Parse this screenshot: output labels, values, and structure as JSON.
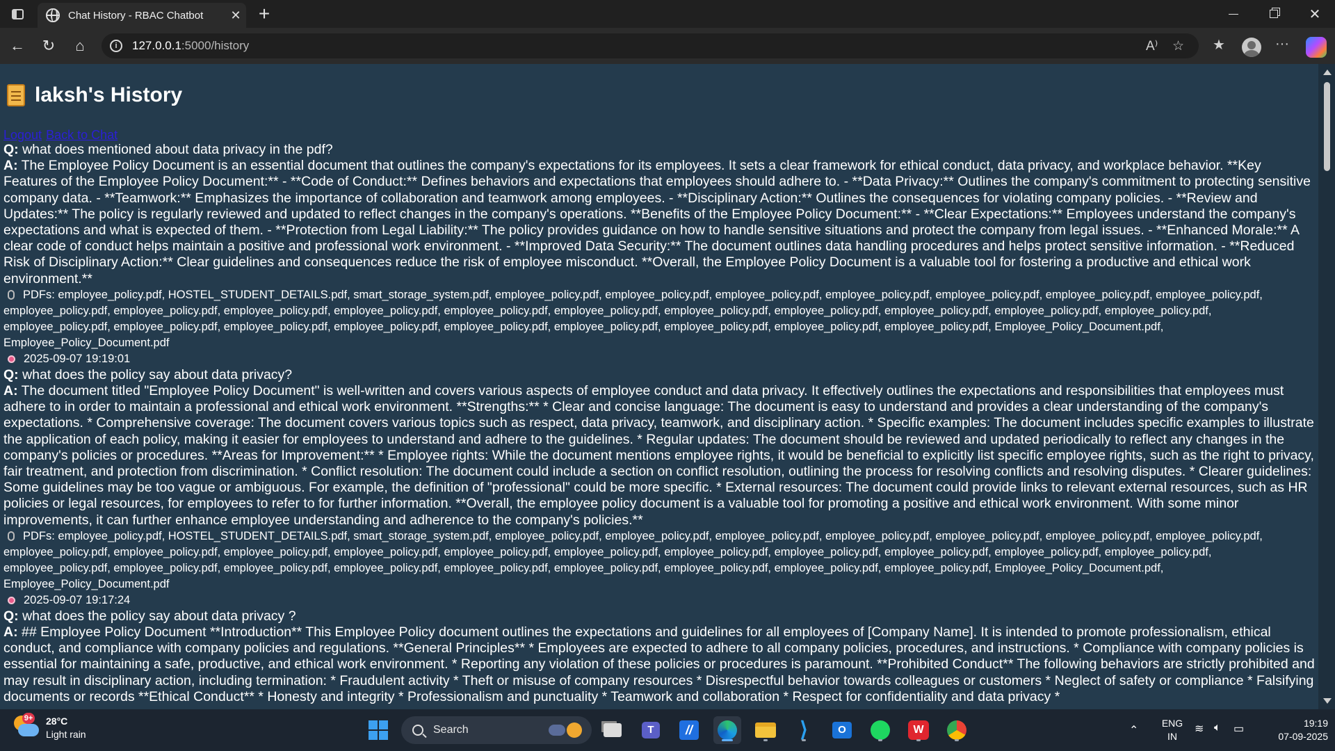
{
  "browser": {
    "tab_title": "Chat History - RBAC Chatbot",
    "tab_close": "✕",
    "new_tab": "+",
    "url_host": "127.0.0.1",
    "url_path": ":5000/history",
    "read_aloud_icon": "A⁾",
    "favorite_star": "☆",
    "favorites_icon": "★",
    "more_menu": "···"
  },
  "page": {
    "title": "laksh's History",
    "links": {
      "logout": "Logout",
      "back_to_chat": "Back to Chat"
    }
  },
  "history": [
    {
      "q_label": "Q:",
      "question": " what does mentioned about data privacy in the pdf?",
      "a_label": "A:",
      "answer": " The Employee Policy Document is an essential document that outlines the company's expectations for its employees. It sets a clear framework for ethical conduct, data privacy, and workplace behavior. **Key Features of the Employee Policy Document:** - **Code of Conduct:** Defines behaviors and expectations that employees should adhere to. - **Data Privacy:** Outlines the company's commitment to protecting sensitive company data. - **Teamwork:** Emphasizes the importance of collaboration and teamwork among employees. - **Disciplinary Action:** Outlines the consequences for violating company policies. - **Review and Updates:** The policy is regularly reviewed and updated to reflect changes in the company's operations. **Benefits of the Employee Policy Document:** - **Clear Expectations:** Employees understand the company's expectations and what is expected of them. - **Protection from Legal Liability:** The policy provides guidance on how to handle sensitive situations and protect the company from legal issues. - **Enhanced Morale:** A clear code of conduct helps maintain a positive and professional work environment. - **Improved Data Security:** The document outlines data handling procedures and helps protect sensitive information. - **Reduced Risk of Disciplinary Action:** Clear guidelines and consequences reduce the risk of employee misconduct. **Overall, the Employee Policy Document is a valuable tool for fostering a productive and ethical work environment.**",
      "pdfs": "PDFs: employee_policy.pdf, HOSTEL_STUDENT_DETAILS.pdf, smart_storage_system.pdf, employee_policy.pdf, employee_policy.pdf, employee_policy.pdf, employee_policy.pdf, employee_policy.pdf, employee_policy.pdf, employee_policy.pdf, employee_policy.pdf, employee_policy.pdf, employee_policy.pdf, employee_policy.pdf, employee_policy.pdf, employee_policy.pdf, employee_policy.pdf, employee_policy.pdf, employee_policy.pdf, employee_policy.pdf, employee_policy.pdf, employee_policy.pdf, employee_policy.pdf, employee_policy.pdf, employee_policy.pdf, employee_policy.pdf, employee_policy.pdf, employee_policy.pdf, employee_policy.pdf, employee_policy.pdf, Employee_Policy_Document.pdf, Employee_Policy_Document.pdf",
      "timestamp": "2025-09-07 19:19:01"
    },
    {
      "q_label": "Q:",
      "question": " what does the policy say about data privacy?",
      "a_label": "A:",
      "answer": " The document titled \"Employee Policy Document\" is well-written and covers various aspects of employee conduct and data privacy. It effectively outlines the expectations and responsibilities that employees must adhere to in order to maintain a professional and ethical work environment. **Strengths:** * Clear and concise language: The document is easy to understand and provides a clear understanding of the company's expectations. * Comprehensive coverage: The document covers various topics such as respect, data privacy, teamwork, and disciplinary action. * Specific examples: The document includes specific examples to illustrate the application of each policy, making it easier for employees to understand and adhere to the guidelines. * Regular updates: The document should be reviewed and updated periodically to reflect any changes in the company's policies or procedures. **Areas for Improvement:** * Employee rights: While the document mentions employee rights, it would be beneficial to explicitly list specific employee rights, such as the right to privacy, fair treatment, and protection from discrimination. * Conflict resolution: The document could include a section on conflict resolution, outlining the process for resolving conflicts and resolving disputes. * Clearer guidelines: Some guidelines may be too vague or ambiguous. For example, the definition of \"professional\" could be more specific. * External resources: The document could provide links to relevant external resources, such as HR policies or legal resources, for employees to refer to for further information. **Overall, the employee policy document is a valuable tool for promoting a positive and ethical work environment. With some minor improvements, it can further enhance employee understanding and adherence to the company's policies.**",
      "pdfs": "PDFs: employee_policy.pdf, HOSTEL_STUDENT_DETAILS.pdf, smart_storage_system.pdf, employee_policy.pdf, employee_policy.pdf, employee_policy.pdf, employee_policy.pdf, employee_policy.pdf, employee_policy.pdf, employee_policy.pdf, employee_policy.pdf, employee_policy.pdf, employee_policy.pdf, employee_policy.pdf, employee_policy.pdf, employee_policy.pdf, employee_policy.pdf, employee_policy.pdf, employee_policy.pdf, employee_policy.pdf, employee_policy.pdf, employee_policy.pdf, employee_policy.pdf, employee_policy.pdf, employee_policy.pdf, employee_policy.pdf, employee_policy.pdf, employee_policy.pdf, employee_policy.pdf, employee_policy.pdf, Employee_Policy_Document.pdf, Employee_Policy_Document.pdf",
      "timestamp": "2025-09-07 19:17:24"
    },
    {
      "q_label": "Q:",
      "question": " what does the policy say about data privacy ?",
      "a_label": "A:",
      "answer": " ## Employee Policy Document **Introduction** This Employee Policy document outlines the expectations and guidelines for all employees of [Company Name]. It is intended to promote professionalism, ethical conduct, and compliance with company policies and regulations. **General Principles** * Employees are expected to adhere to all company policies, procedures, and instructions. * Compliance with company policies is essential for maintaining a safe, productive, and ethical work environment. * Reporting any violation of these policies or procedures is paramount. **Prohibited Conduct** The following behaviors are strictly prohibited and may result in disciplinary action, including termination: * Fraudulent activity * Theft or misuse of company resources * Disrespectful behavior towards colleagues or customers * Neglect of safety or compliance * Falsifying documents or records **Ethical Conduct** * Honesty and integrity * Professionalism and punctuality * Teamwork and collaboration * Respect for confidentiality and data privacy *",
      "pdfs": "",
      "timestamp": ""
    }
  ],
  "taskbar": {
    "weather_badge": "9+",
    "temperature": "28°C",
    "condition": "Light rain",
    "search_label": "Search",
    "language_line1": "ENG",
    "language_line2": "IN",
    "time": "19:19",
    "date": "07-09-2025"
  },
  "colors": {
    "page_bg": "#243b4d",
    "link": "#2b1fd6",
    "text": "#ffffff"
  }
}
